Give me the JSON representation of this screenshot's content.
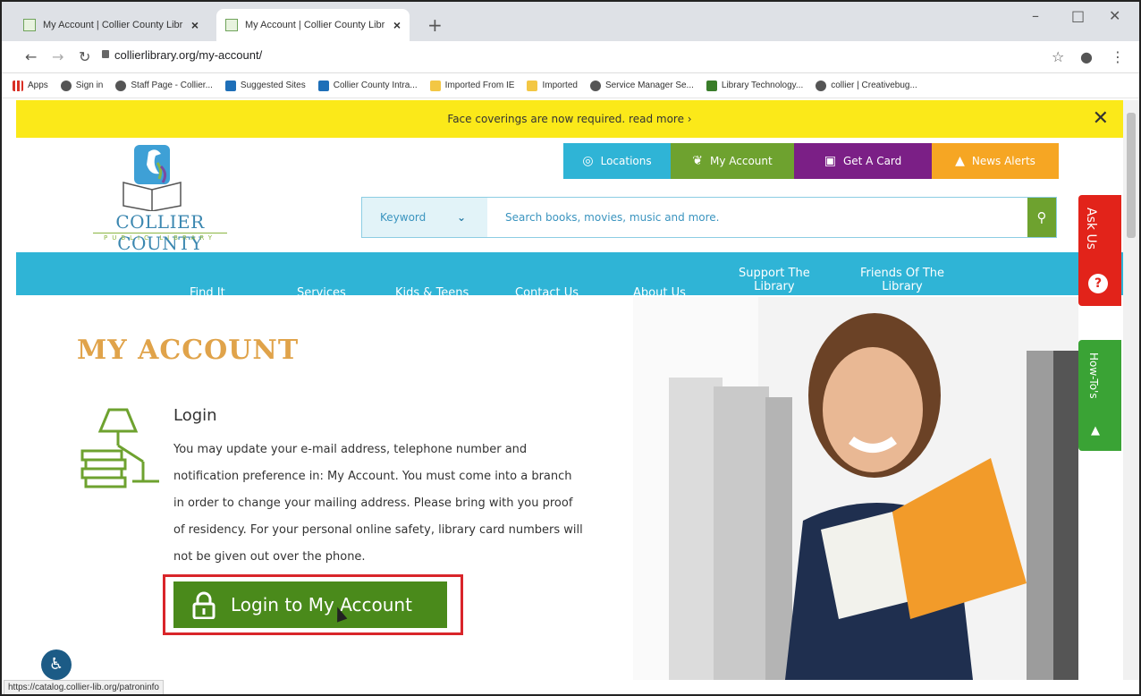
{
  "browser": {
    "tabs": [
      {
        "title": "My Account | Collier County Libr"
      },
      {
        "title": "My Account | Collier County Libr"
      }
    ],
    "url": "collierlibrary.org/my-account/",
    "bookmarks": [
      {
        "label": "Apps",
        "icon": "apps-icon"
      },
      {
        "label": "Sign in",
        "icon": "globe-icon"
      },
      {
        "label": "Staff Page - Collier...",
        "icon": "globe-icon"
      },
      {
        "label": "Suggested Sites",
        "icon": "bookmark-icon"
      },
      {
        "label": "Collier County Intra...",
        "icon": "sharepoint-icon"
      },
      {
        "label": "Imported From IE",
        "icon": "folder-icon"
      },
      {
        "label": "Imported",
        "icon": "folder-icon"
      },
      {
        "label": "Service Manager Se...",
        "icon": "globe-icon"
      },
      {
        "label": "Library Technology...",
        "icon": "bookmark-icon"
      },
      {
        "label": "collier | Creativebug...",
        "icon": "globe-icon"
      }
    ],
    "status_url": "https://catalog.collier-lib.org/patroninfo"
  },
  "alert": {
    "text": "Face coverings are now required. read more ›"
  },
  "logo": {
    "name": "COLLIER COUNTY",
    "sub": "PUBLIC LIBRARY"
  },
  "top_buttons": {
    "locations": "Locations",
    "my_account": "My Account",
    "get_card": "Get A Card",
    "news": "News Alerts"
  },
  "search": {
    "keyword_label": "Keyword",
    "placeholder": "Search books, movies, music and more."
  },
  "nav": {
    "find_it": "Find It",
    "services": "Services",
    "kids_teens": "Kids & Teens",
    "contact_us": "Contact Us",
    "about_us": "About Us",
    "support": [
      "Support The",
      "Library"
    ],
    "friends": [
      "Friends Of The",
      "Library"
    ]
  },
  "side_tabs": {
    "ask_us": "Ask Us",
    "how_tos": "How-To's"
  },
  "page": {
    "title": "MY ACCOUNT",
    "login_title": "Login",
    "login_body": "You may update your e-mail address, telephone number and notification preference in: My Account. You must come into a branch in order to change your mailing address. Please bring with you proof of residency. For your personal online safety, library card numbers will not be given out over the phone.",
    "login_button": "Login to My Account"
  },
  "colors": {
    "alert": "#fbe919",
    "cyan": "#2fb4d6",
    "green": "#6ea22f",
    "purple": "#7b1f86",
    "orange": "#f6a623",
    "red": "#e2231a",
    "title_gold": "#e0a34a"
  }
}
